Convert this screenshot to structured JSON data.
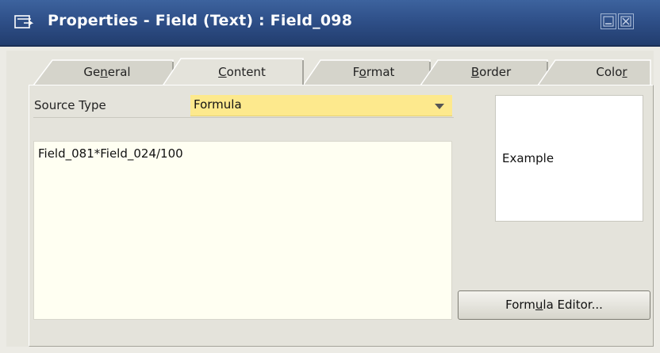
{
  "window": {
    "title": "Properties - Field (Text) : Field_098"
  },
  "tabs": [
    {
      "pre": "Ge",
      "key": "n",
      "post": "eral",
      "active": false
    },
    {
      "pre": "",
      "key": "C",
      "post": "ontent",
      "active": true
    },
    {
      "pre": "F",
      "key": "o",
      "post": "rmat",
      "active": false
    },
    {
      "pre": "",
      "key": "B",
      "post": "order",
      "active": false
    },
    {
      "pre": "Colo",
      "key": "r",
      "post": "",
      "active": false
    }
  ],
  "content": {
    "source_type_label": "Source Type",
    "source_type_value": "Formula",
    "formula_text": "Field_081*Field_024/100",
    "example_text": "Example",
    "formula_editor_button": {
      "pre": "Form",
      "key": "u",
      "post": "la Editor..."
    }
  },
  "colors": {
    "titlebar": "#2f5089",
    "select_highlight": "#fde98d",
    "formula_background": "#fffff2"
  },
  "icons": {
    "title": "properties-icon",
    "minimize": "minimize-icon",
    "close": "close-icon",
    "dropdown": "chevron-down-icon"
  }
}
